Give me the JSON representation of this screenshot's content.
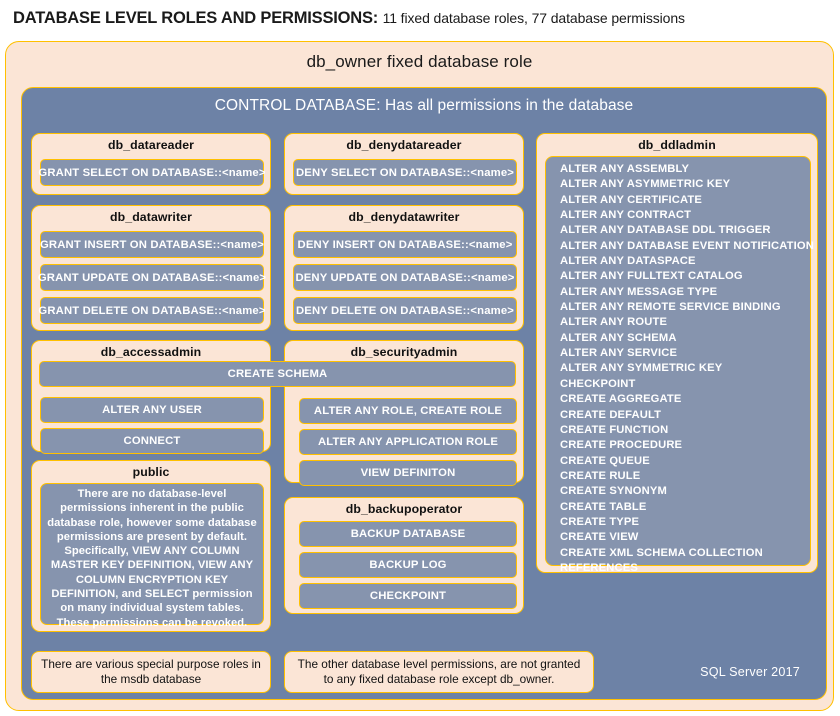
{
  "header": {
    "title": "DATABASE LEVEL ROLES AND PERMISSIONS:",
    "subtitle": "11 fixed database roles, 77 database permissions"
  },
  "owner_panel": {
    "title": "db_owner  fixed database role",
    "control_bar": "CONTROL DATABASE:  Has all permissions  in the database"
  },
  "roles": {
    "db_datareader": {
      "title": "db_datareader",
      "permissions": [
        "GRANT SELECT  ON DATABASE::<name>"
      ]
    },
    "db_datawriter": {
      "title": "db_datawriter",
      "permissions": [
        "GRANT INSERT  ON DATABASE::<name>",
        "GRANT UPDATE  ON DATABASE::<name>",
        "GRANT DELETE  ON DATABASE::<name>"
      ]
    },
    "db_denydatareader": {
      "title": "db_denydatareader",
      "permissions": [
        "DENY SELECT ON DATABASE::<name>"
      ]
    },
    "db_denydatawriter": {
      "title": "db_denydatawriter",
      "permissions": [
        "DENY INSERT  ON DATABASE::<name>",
        "DENY UPDATE  ON DATABASE::<name>",
        "DENY DELETE  ON DATABASE::<name>"
      ]
    },
    "db_accessadmin": {
      "title": "db_accessadmin",
      "permissions": [
        "ALTER ANY USER",
        "CONNECT"
      ]
    },
    "db_securityadmin": {
      "title": "db_securityadmin",
      "permissions": [
        "ALTER ANY ROLE, CREATE  ROLE",
        "ALTER ANY APPLICATION  ROLE",
        "VIEW  DEFINITON"
      ]
    },
    "shared": {
      "create_schema": "CREATE  SCHEMA"
    },
    "db_backupoperator": {
      "title": "db_backupoperator",
      "permissions": [
        "BACKUP  DATABASE",
        "BACKUP  LOG",
        "CHECKPOINT"
      ]
    },
    "public": {
      "title": "public",
      "note": "There are no database-level  permissions  inherent in  the public  database  role,  however some database  permissions are  present by default. Specifically,   VIEW  ANY COLUMN  MASTER  KEY DEFINITION,  VIEW  ANY COLUMN  ENCRYPTION  KEY  DEFINITION,  and SELECT  permission on  many  individual  system tables. These  permissions can  be revoked."
    },
    "db_ddladmin": {
      "title": "db_ddladmin",
      "permissions": [
        "ALTER ANY ASSEMBLY",
        "ALTER ANY ASYMMETRIC  KEY",
        "ALTER ANY CERTIFICATE",
        "ALTER ANY CONTRACT",
        "ALTER ANY DATABASE  DDL  TRIGGER",
        "ALTER ANY DATABASE  EVENT  NOTIFICATION",
        "ALTER ANY DATASPACE",
        "ALTER ANY FULLTEXT  CATALOG",
        "ALTER ANY MESSAGE  TYPE",
        "ALTER ANY REMOTE  SERVICE  BINDING",
        "ALTER ANY ROUTE",
        "ALTER ANY SCHEMA",
        "ALTER ANY SERVICE",
        "ALTER ANY SYMMETRIC  KEY",
        "CHECKPOINT",
        "CREATE  AGGREGATE",
        "CREATE  DEFAULT",
        "CREATE  FUNCTION",
        "CREATE  PROCEDURE",
        "CREATE  QUEUE",
        "CREATE  RULE",
        "CREATE  SYNONYM",
        "CREATE  TABLE",
        "CREATE  TYPE",
        "CREATE  VIEW",
        "CREATE  XML SCHEMA  COLLECTION",
        "REFERENCES"
      ]
    }
  },
  "footer": {
    "note_left": "There are various special  purpose roles in the msdb database",
    "note_right": "The other database level permissions, are not granted to any fixed database  role except db_owner.",
    "stamp": "SQL Server 2017"
  },
  "colors": {
    "cream": "#fbe5d6",
    "gold_border": "#ffc000",
    "slate_panel": "#6d82a6",
    "slate_pill": "#8694ae",
    "text_dark": "#111111",
    "text_light": "#ffffff"
  }
}
